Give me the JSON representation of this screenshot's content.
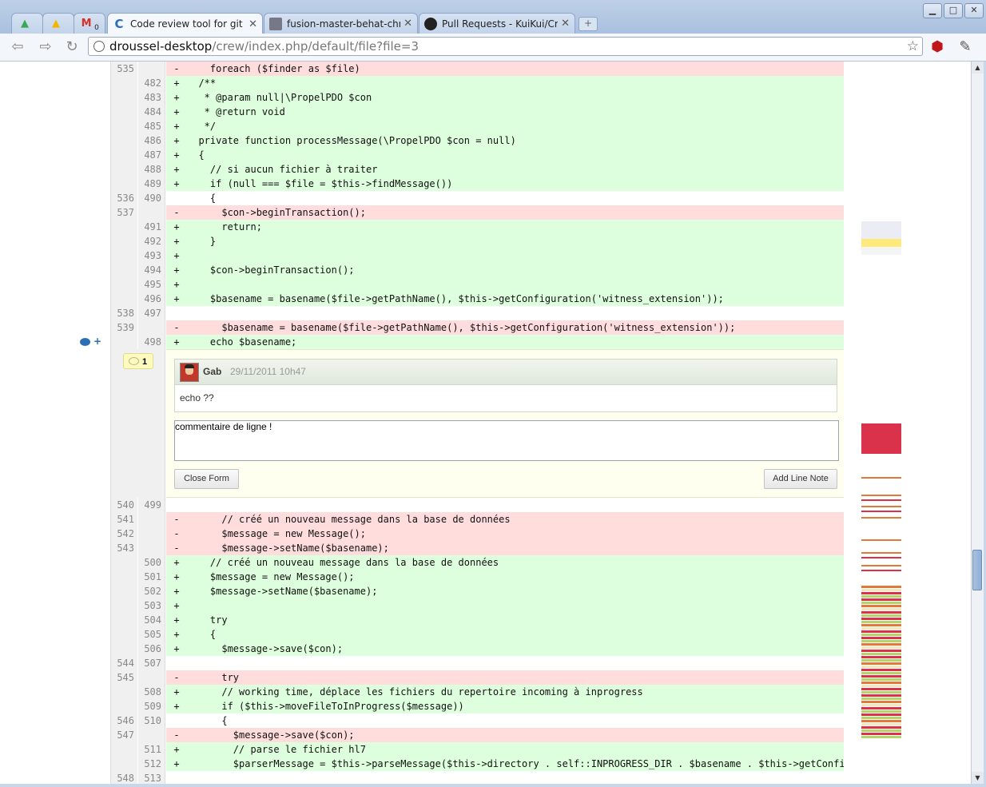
{
  "browser": {
    "tabs": [
      {
        "label": "",
        "icon": "drive-icon"
      },
      {
        "label": "",
        "icon": "drive-icon"
      },
      {
        "label": "0",
        "icon": "gmail-icon"
      },
      {
        "label": "Code review tool for git p",
        "icon": "crew-icon",
        "active": true
      },
      {
        "label": "fusion-master-behat-chro",
        "icon": "avatar-icon"
      },
      {
        "label": "Pull Requests - KuiKui/Cre",
        "icon": "github-icon"
      }
    ],
    "new_tab_label": "+",
    "window_buttons": {
      "minimize": "▁",
      "maximize": "□",
      "close": "✕"
    },
    "url_host": "droussel-desktop",
    "url_path": "/crew/index.php/default/file?file=3"
  },
  "diff": {
    "top_rows": [
      {
        "type": "del",
        "old": "535",
        "new": "",
        "sign": "-",
        "code": "    foreach ($finder as $file)"
      },
      {
        "type": "add",
        "old": "",
        "new": "482",
        "sign": "+",
        "code": "  /**"
      },
      {
        "type": "add",
        "old": "",
        "new": "483",
        "sign": "+",
        "code": "   * @param null|\\PropelPDO $con"
      },
      {
        "type": "add",
        "old": "",
        "new": "484",
        "sign": "+",
        "code": "   * @return void"
      },
      {
        "type": "add",
        "old": "",
        "new": "485",
        "sign": "+",
        "code": "   */"
      },
      {
        "type": "add",
        "old": "",
        "new": "486",
        "sign": "+",
        "code": "  private function processMessage(\\PropelPDO $con = null)"
      },
      {
        "type": "add",
        "old": "",
        "new": "487",
        "sign": "+",
        "code": "  {"
      },
      {
        "type": "add",
        "old": "",
        "new": "488",
        "sign": "+",
        "code": "    // si aucun fichier à traiter"
      },
      {
        "type": "add",
        "old": "",
        "new": "489",
        "sign": "+",
        "code": "    if (null === $file = $this->findMessage())"
      },
      {
        "type": "ctx",
        "old": "536",
        "new": "490",
        "sign": "",
        "code": "    {"
      },
      {
        "type": "del",
        "old": "537",
        "new": "",
        "sign": "-",
        "code": "      $con->beginTransaction();"
      },
      {
        "type": "add",
        "old": "",
        "new": "491",
        "sign": "+",
        "code": "      return;"
      },
      {
        "type": "add",
        "old": "",
        "new": "492",
        "sign": "+",
        "code": "    }"
      },
      {
        "type": "add",
        "old": "",
        "new": "493",
        "sign": "+",
        "code": ""
      },
      {
        "type": "add",
        "old": "",
        "new": "494",
        "sign": "+",
        "code": "    $con->beginTransaction();"
      },
      {
        "type": "add",
        "old": "",
        "new": "495",
        "sign": "+",
        "code": ""
      },
      {
        "type": "add",
        "old": "",
        "new": "496",
        "sign": "+",
        "code": "    $basename = basename($file->getPathName(), $this->getConfiguration('witness_extension'));"
      },
      {
        "type": "ctx",
        "old": "538",
        "new": "497",
        "sign": "",
        "code": ""
      },
      {
        "type": "del",
        "old": "539",
        "new": "",
        "sign": "-",
        "code": "      $basename = basename($file->getPathName(), $this->getConfiguration('witness_extension'));"
      },
      {
        "type": "add",
        "old": "",
        "new": "498",
        "sign": "+",
        "code": "    echo $basename;"
      }
    ],
    "bottom_rows": [
      {
        "type": "ctx",
        "old": "540",
        "new": "499",
        "sign": "",
        "code": ""
      },
      {
        "type": "del",
        "old": "541",
        "new": "",
        "sign": "-",
        "code": "      // créé un nouveau message dans la base de données"
      },
      {
        "type": "del",
        "old": "542",
        "new": "",
        "sign": "-",
        "code": "      $message = new Message();"
      },
      {
        "type": "del",
        "old": "543",
        "new": "",
        "sign": "-",
        "code": "      $message->setName($basename);"
      },
      {
        "type": "add",
        "old": "",
        "new": "500",
        "sign": "+",
        "code": "    // créé un nouveau message dans la base de données"
      },
      {
        "type": "add",
        "old": "",
        "new": "501",
        "sign": "+",
        "code": "    $message = new Message();"
      },
      {
        "type": "add",
        "old": "",
        "new": "502",
        "sign": "+",
        "code": "    $message->setName($basename);"
      },
      {
        "type": "add",
        "old": "",
        "new": "503",
        "sign": "+",
        "code": ""
      },
      {
        "type": "add",
        "old": "",
        "new": "504",
        "sign": "+",
        "code": "    try"
      },
      {
        "type": "add",
        "old": "",
        "new": "505",
        "sign": "+",
        "code": "    {"
      },
      {
        "type": "add",
        "old": "",
        "new": "506",
        "sign": "+",
        "code": "      $message->save($con);"
      },
      {
        "type": "ctx",
        "old": "544",
        "new": "507",
        "sign": "",
        "code": ""
      },
      {
        "type": "del",
        "old": "545",
        "new": "",
        "sign": "-",
        "code": "      try"
      },
      {
        "type": "add",
        "old": "",
        "new": "508",
        "sign": "+",
        "code": "      // working time, déplace les fichiers du repertoire incoming à inprogress"
      },
      {
        "type": "add",
        "old": "",
        "new": "509",
        "sign": "+",
        "code": "      if ($this->moveFileToInProgress($message))"
      },
      {
        "type": "ctx",
        "old": "546",
        "new": "510",
        "sign": "",
        "code": "      {"
      },
      {
        "type": "del",
        "old": "547",
        "new": "",
        "sign": "-",
        "code": "        $message->save($con);"
      },
      {
        "type": "add",
        "old": "",
        "new": "511",
        "sign": "+",
        "code": "        // parse le fichier hl7"
      },
      {
        "type": "add",
        "old": "",
        "new": "512",
        "sign": "+",
        "code": "        $parserMessage = $this->parseMessage($this->directory . self::INPROGRESS_DIR . $basename . $this->getConfigura"
      },
      {
        "type": "ctx",
        "old": "548",
        "new": "513",
        "sign": "",
        "code": ""
      }
    ]
  },
  "note": {
    "margin_plus": "+",
    "comment_count": "1",
    "author": "Gab",
    "date": "29/11/2011 10h47",
    "body": "echo ??",
    "input_value": "commentaire de ligne !",
    "close_label": "Close Form",
    "add_label": "Add Line Note"
  },
  "colors": {
    "added": "#ddffdd",
    "removed": "#ffdddd",
    "minimap_red": "#d9324a",
    "minimap_orange": "#e07a3a",
    "minimap_green": "#b7d46a"
  }
}
